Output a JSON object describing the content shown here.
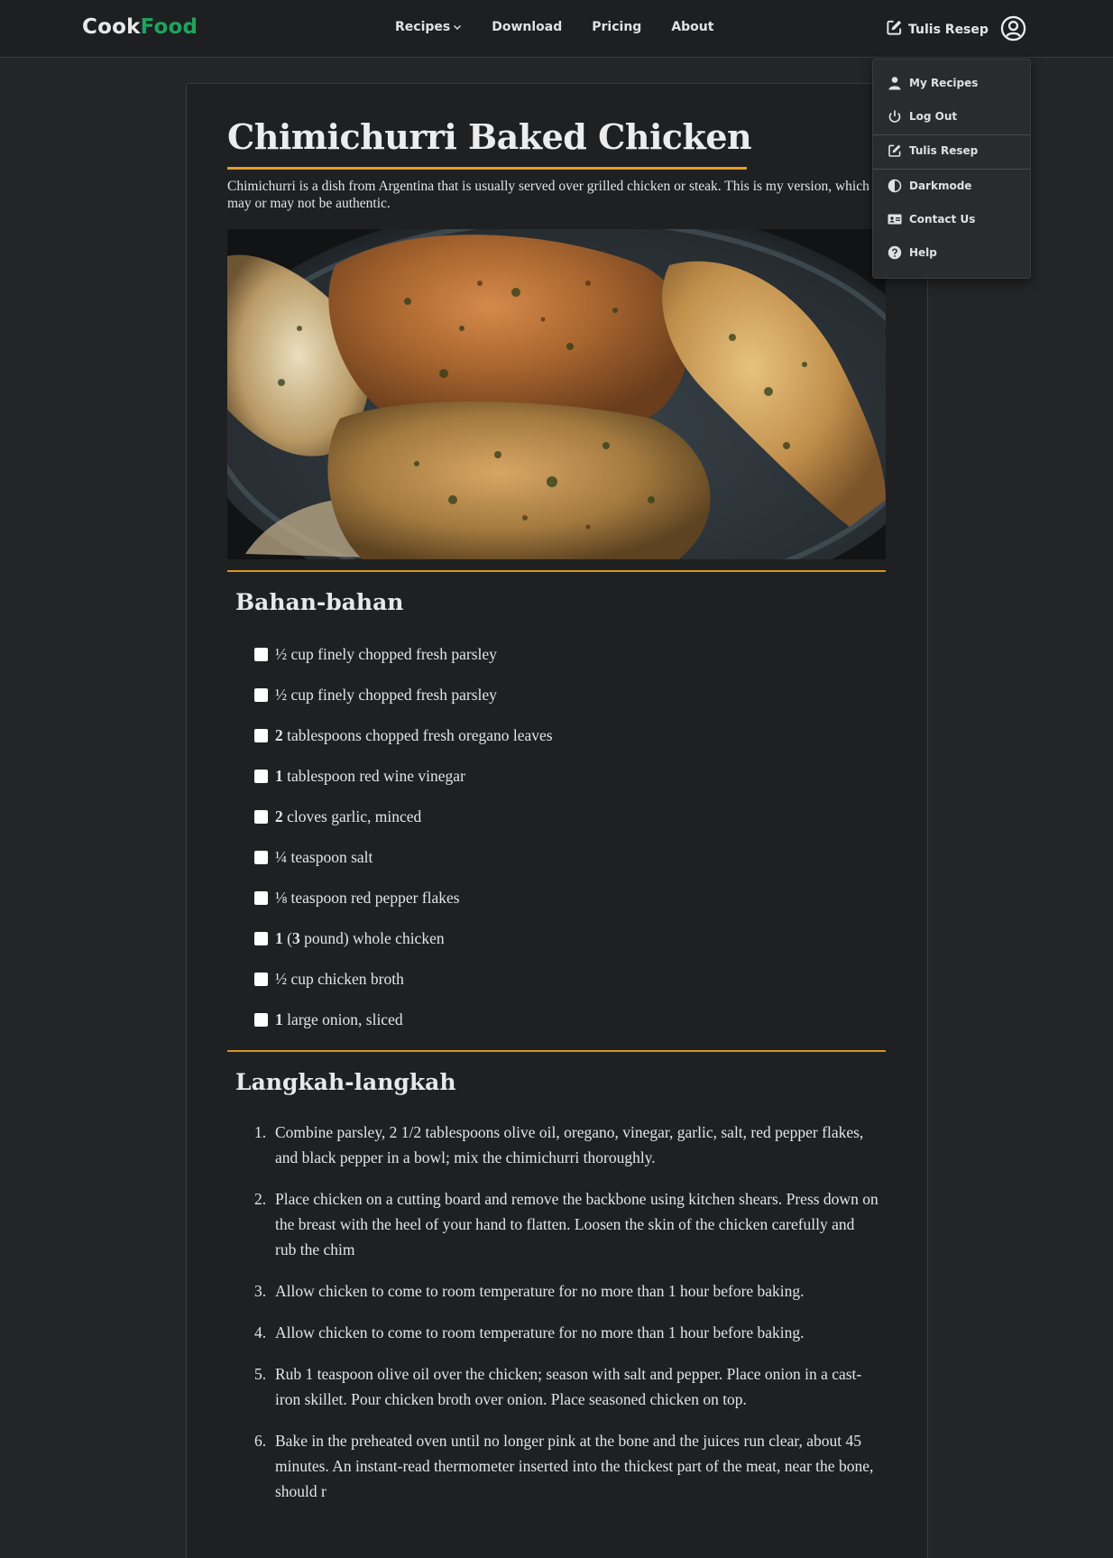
{
  "brand": {
    "part1": "Cook",
    "part2": "Food"
  },
  "nav": {
    "recipes": "Recipes",
    "download": "Download",
    "pricing": "Pricing",
    "about": "About"
  },
  "header": {
    "write_recipe": "Tulis Resep"
  },
  "dropdown": {
    "my_recipes": "My Recipes",
    "log_out": "Log Out",
    "write_recipe": "Tulis Resep",
    "darkmode": "Darkmode",
    "contact_us": "Contact Us",
    "help": "Help"
  },
  "recipe": {
    "title": "Chimichurri Baked Chicken",
    "description": "Chimichurri is a dish from Argentina that is usually served over grilled chicken or steak. This is my version, which may or may not be authentic.",
    "ingredients_title": "Bahan-bahan",
    "ingredients": [
      {
        "qty": "",
        "text": "½ cup finely chopped fresh parsley"
      },
      {
        "qty": "",
        "text": "½ cup finely chopped fresh parsley"
      },
      {
        "qty": "2",
        "text": " tablespoons chopped fresh oregano leaves"
      },
      {
        "qty": "1",
        "text": " tablespoon red wine vinegar"
      },
      {
        "qty": "2",
        "text": " cloves garlic, minced"
      },
      {
        "qty": "",
        "text": "¼ teaspoon salt"
      },
      {
        "qty": "",
        "text": "⅛ teaspoon red pepper flakes"
      },
      {
        "qty": "1",
        "text": " (",
        "qty2": "3",
        "text2": " pound) whole chicken"
      },
      {
        "qty": "",
        "text": "½ cup chicken broth"
      },
      {
        "qty": "1",
        "text": " large onion, sliced"
      }
    ],
    "steps_title": "Langkah-langkah",
    "steps": [
      {
        "num": "1.",
        "text": "Combine parsley, 2 1/2 tablespoons olive oil, oregano, vinegar, garlic, salt, red pepper flakes, and black pepper in a bowl; mix the chimichurri thoroughly."
      },
      {
        "num": "2.",
        "text": "Place chicken on a cutting board and remove the backbone using kitchen shears. Press down on the breast with the heel of your hand to flatten. Loosen the skin of the chicken carefully and rub the chim"
      },
      {
        "num": "3.",
        "text": "Allow chicken to come to room temperature for no more than 1 hour before baking."
      },
      {
        "num": "4.",
        "text": "Allow chicken to come to room temperature for no more than 1 hour before baking."
      },
      {
        "num": "5.",
        "text": "Rub 1 teaspoon olive oil over the chicken; season with salt and pepper. Place onion in a cast-iron skillet. Pour chicken broth over onion. Place seasoned chicken on top."
      },
      {
        "num": "6.",
        "text": "Bake in the preheated oven until no longer pink at the bone and the juices run clear, about 45 minutes. An instant-read thermometer inserted into the thickest part of the meat, near the bone, should r"
      }
    ]
  },
  "colors": {
    "background": "#242526",
    "navbar": "#1e1f21",
    "brand_accent": "#1fa35c",
    "divider_accent": "#e0a023"
  },
  "icons": {
    "nav_recipes_chevron": "chevron-down-icon",
    "write": "edit-icon",
    "account": "user-circle-icon",
    "my_recipes": "user-icon",
    "log_out": "power-icon",
    "darkmode": "half-circle-icon",
    "contact": "contact-card-icon",
    "help": "help-circle-icon"
  }
}
